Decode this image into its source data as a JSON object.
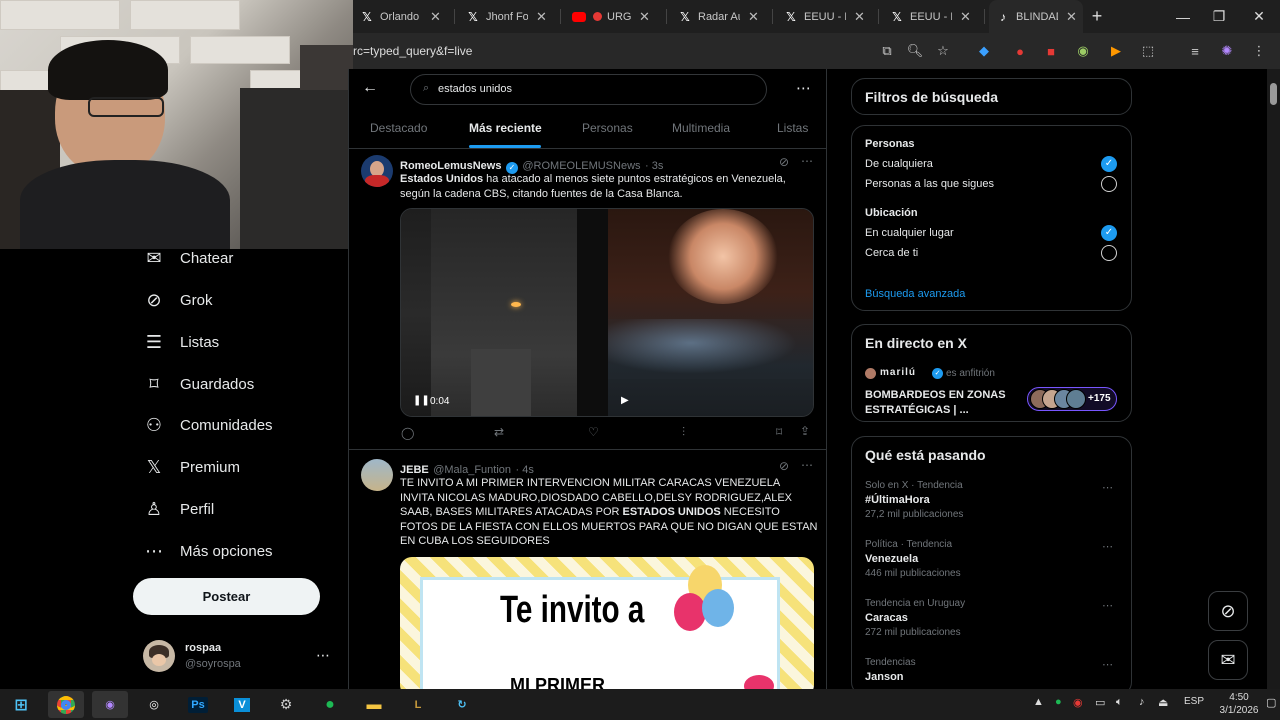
{
  "browser": {
    "tabs": [
      {
        "label": "Orlando",
        "icon": "x-icon"
      },
      {
        "label": "Jhonf Fo",
        "icon": "x-icon"
      },
      {
        "label": "URGE",
        "icon": "youtube-icon"
      },
      {
        "label": "Radar Au",
        "icon": "x-icon"
      },
      {
        "label": "EEUU - B",
        "icon": "x-icon"
      },
      {
        "label": "EEUU - B",
        "icon": "x-icon"
      },
      {
        "label": "BLINDAD",
        "icon": "tiktok-icon"
      }
    ],
    "url": "rc=typed_query&f=live"
  },
  "nav": {
    "items": [
      {
        "label": "Chatear",
        "icon": "chat-icon"
      },
      {
        "label": "Grok",
        "icon": "grok-icon"
      },
      {
        "label": "Listas",
        "icon": "list-icon"
      },
      {
        "label": "Guardados",
        "icon": "bookmark-icon"
      },
      {
        "label": "Comunidades",
        "icon": "communities-icon"
      },
      {
        "label": "Premium",
        "icon": "x-logo-icon"
      },
      {
        "label": "Perfil",
        "icon": "profile-icon"
      },
      {
        "label": "Más opciones",
        "icon": "more-options-icon"
      }
    ],
    "post_label": "Postear",
    "account": {
      "name": "rospaa",
      "handle": "@soyrospa"
    }
  },
  "search": {
    "query": "estados unidos",
    "tabs": [
      "Destacado",
      "Más reciente",
      "Personas",
      "Multimedia",
      "Listas"
    ],
    "active_tab": "Más reciente"
  },
  "tweets": [
    {
      "name": "RomeoLemusNews",
      "handle": "@ROMEOLEMUSNews",
      "time": "· 3s",
      "verified": true,
      "text_bold": "Estados Unidos",
      "text_line1_rest": " ha atacado al menos siete puntos estratégicos en Venezuela,",
      "text_line2": "según la cadena CBS, citando fuentes de la Casa Blanca.",
      "video_time": "0:04"
    },
    {
      "name": "JEBE",
      "handle": "@Mala_Funtion",
      "time": "· 4s",
      "lines": [
        "TE INVITO A MI PRIMER INTERVENCION MILITAR CARACAS VENEZUELA",
        "INVITA NICOLAS MADURO,DIOSDADO CABELLO,DELSY RODRIGUEZ,ALEX",
        "SAAB, BASES MILITARES ATACADAS POR "
      ],
      "bold_inline": "ESTADOS UNIDOS",
      "line3_tail": " NECESITO",
      "lines_after": [
        "FOTOS DE LA FIESTA CON ELLOS MUERTOS PARA QUE NO DIGAN QUE ESTAN",
        "EN CUBA LOS SEGUIDORES"
      ],
      "image_text_1": "Te invito a",
      "image_text_2": "MI PRIMER"
    }
  ],
  "filters": {
    "title": "Filtros de búsqueda",
    "people_head": "Personas",
    "people_opts": [
      "De cualquiera",
      "Personas a las que sigues"
    ],
    "location_head": "Ubicación",
    "location_opts": [
      "En cualquier lugar",
      "Cerca de ti"
    ],
    "advanced": "Búsqueda avanzada"
  },
  "live": {
    "title": "En directo en X",
    "host": "marilú",
    "host_role": "es anfitrión",
    "headline_1": "BOMBARDEOS EN ZONAS",
    "headline_2": "ESTRATÉGICAS | ...",
    "listeners": "+175"
  },
  "trends": {
    "title": "Qué está pasando",
    "items": [
      {
        "meta": "Solo en X · Tendencia",
        "name": "#ÚltimaHora",
        "count": "27,2 mil publicaciones"
      },
      {
        "meta": "Política · Tendencia",
        "name": "Venezuela",
        "count": "446 mil publicaciones"
      },
      {
        "meta": "Tendencia en Uruguay",
        "name": "Caracas",
        "count": "272 mil publicaciones"
      },
      {
        "meta": "Tendencias",
        "name": "Janson",
        "count": ""
      }
    ]
  },
  "taskbar": {
    "lang": "ESP",
    "time": "4:50",
    "date": "3/1/2026"
  },
  "colors": {
    "accent": "#1d9bf0",
    "background": "#000000",
    "border": "#2f3336"
  }
}
